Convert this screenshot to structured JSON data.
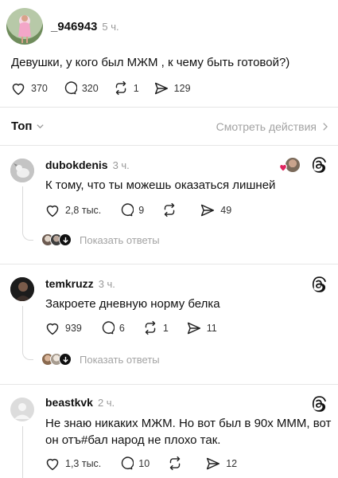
{
  "post": {
    "username": "_946943",
    "time": "5 ч.",
    "text": "Девушки, у кого был МЖМ , к чему быть готовой?)",
    "likes": "370",
    "comments": "320",
    "reposts": "1",
    "shares": "129"
  },
  "sort": {
    "label": "Топ",
    "view_actions": "Смотреть действия"
  },
  "comments": [
    {
      "username": "dubokdenis",
      "time": "3 ч.",
      "text": "К тому, что ты можешь оказаться лишней",
      "likes": "2,8 тыс.",
      "comments": "9",
      "reposts": "",
      "shares": "49",
      "show_replies": "Показать ответы"
    },
    {
      "username": "temkruzz",
      "time": "3 ч.",
      "text": "Закроете дневную норму белка",
      "likes": "939",
      "comments": "6",
      "reposts": "1",
      "shares": "11",
      "show_replies": "Показать ответы"
    },
    {
      "username": "beastkvk",
      "time": "2 ч.",
      "text_line1": "Не знаю никаких МЖМ. Но вот был в 90х МММ, вот",
      "text_line2": "он отъ#бал народ не плохо так.",
      "likes": "1,3 тыс.",
      "comments": "10",
      "reposts": "",
      "shares": "12"
    }
  ],
  "colors": {
    "accent_heart": "#e0245e",
    "muted": "#999999"
  }
}
